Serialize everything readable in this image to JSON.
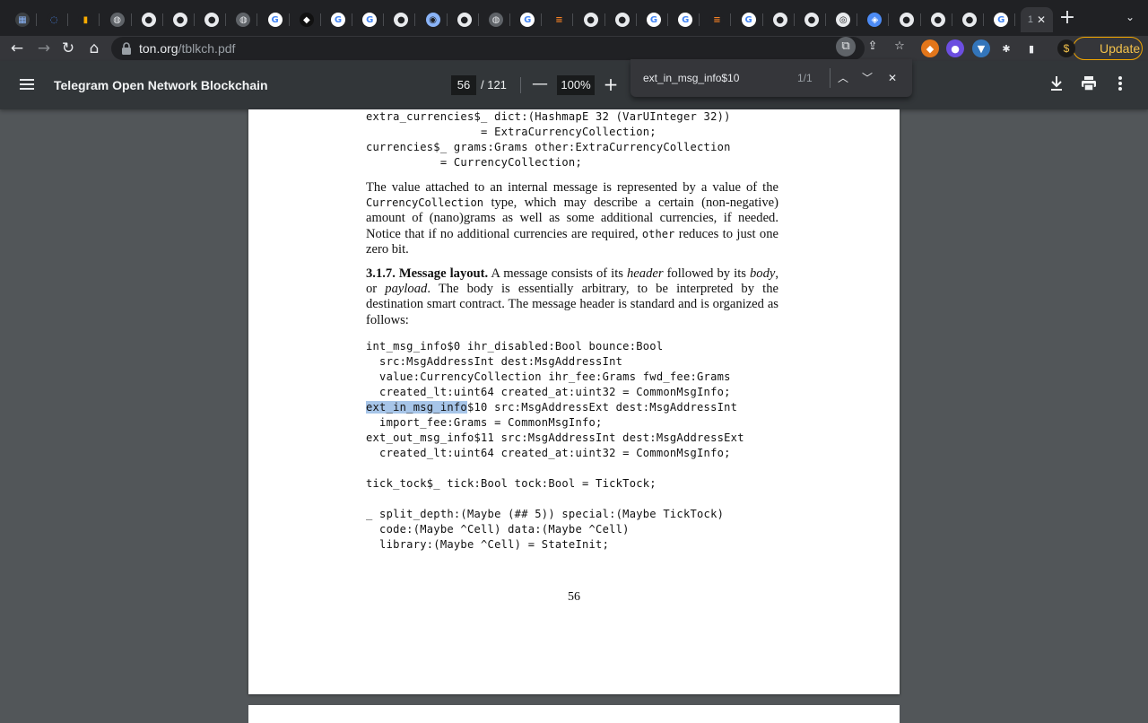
{
  "tabs": {
    "active_label": "1",
    "close": "✕",
    "new_tab": "+",
    "tab_search": "⌄"
  },
  "toolbar": {
    "back": "←",
    "forward": "→",
    "reload": "↻",
    "home": "⌂",
    "url_host": "ton.org",
    "url_path": "/tblkch.pdf",
    "update_label": "Update"
  },
  "pdf": {
    "title": "Telegram Open Network Blockchain",
    "current_page": "56",
    "total_pages": "/ 121",
    "zoom": "100%",
    "zoom_out": "—",
    "zoom_in": "+"
  },
  "find": {
    "query": "ext_in_msg_info$10",
    "count": "1/1",
    "prev": "︿",
    "next": "﹀",
    "close": "✕"
  },
  "document": {
    "code1": [
      "extra_currencies$_ dict:(HashmapE 32 (VarUInteger 32))",
      "                 = ExtraCurrencyCollection;",
      "currencies$_ grams:Grams other:ExtraCurrencyCollection",
      "           = CurrencyCollection;"
    ],
    "para1_a": "The value attached to an internal message is represented by a value of the ",
    "para1_code1": "CurrencyCollection",
    "para1_b": " type, which may describe a certain (non-negative) amount of (nano)grams as well as some additional currencies, if needed. Notice that if no additional currencies are required, ",
    "para1_code2": "other",
    "para1_c": " reduces to just one zero bit.",
    "section_heading": "3.1.7. Message layout.",
    "para2_a": " A message consists of its ",
    "para2_header": "header",
    "para2_b": " followed by its ",
    "para2_body": "body",
    "para2_c": ", or ",
    "para2_payload": "payload",
    "para2_d": ". The body is essentially arbitrary, to be interpreted by the destination smart contract. The message header is standard and is organized as follows:",
    "code2": [
      "int_msg_info$0 ihr_disabled:Bool bounce:Bool",
      "  src:MsgAddressInt dest:MsgAddressInt",
      "  value:CurrencyCollection ihr_fee:Grams fwd_fee:Grams",
      "  created_lt:uint64 created_at:uint32 = CommonMsgInfo;"
    ],
    "code2_hl": "ext_in_msg_info",
    "code2_hl_rest": "$10 src:MsgAddressExt dest:MsgAddressInt",
    "code3": [
      "  import_fee:Grams = CommonMsgInfo;",
      "ext_out_msg_info$11 src:MsgAddressInt dest:MsgAddressExt",
      "  created_lt:uint64 created_at:uint32 = CommonMsgInfo;",
      "",
      "tick_tock$_ tick:Bool tock:Bool = TickTock;",
      "",
      "_ split_depth:(Maybe (## 5)) special:(Maybe TickTock)",
      "  code:(Maybe ^Cell) data:(Maybe ^Cell)",
      "  library:(Maybe ^Cell) = StateInit;"
    ],
    "page_number": "56"
  }
}
